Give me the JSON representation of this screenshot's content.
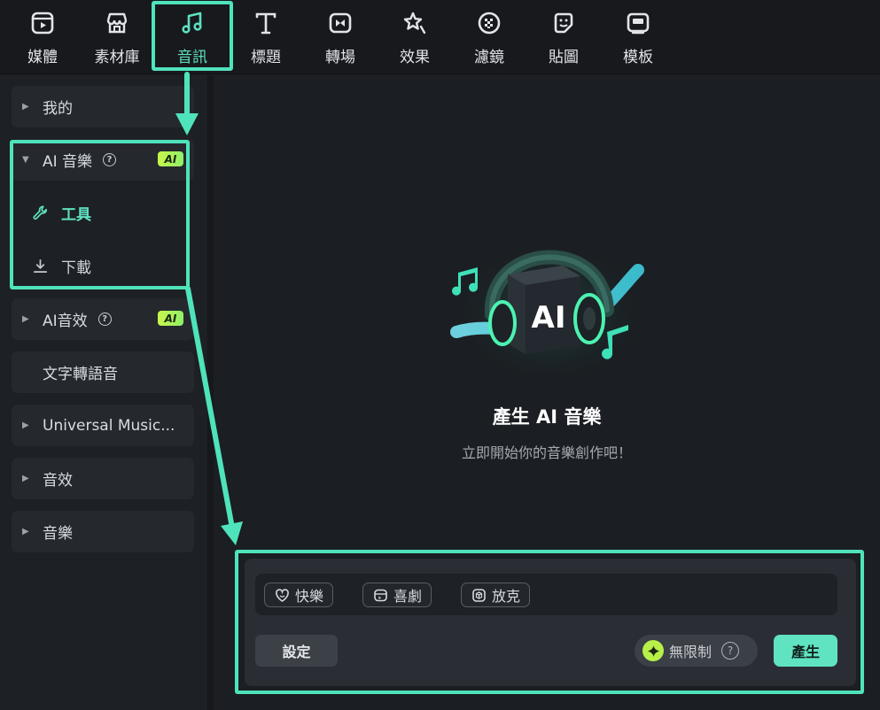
{
  "toolbar": {
    "items": [
      {
        "label": "媒體",
        "icon": "media-icon"
      },
      {
        "label": "素材庫",
        "icon": "store-icon"
      },
      {
        "label": "音訊",
        "icon": "music-note-icon"
      },
      {
        "label": "標題",
        "icon": "title-t-icon"
      },
      {
        "label": "轉場",
        "icon": "transition-icon"
      },
      {
        "label": "效果",
        "icon": "effects-icon"
      },
      {
        "label": "濾鏡",
        "icon": "filter-icon"
      },
      {
        "label": "貼圖",
        "icon": "sticker-icon"
      },
      {
        "label": "模板",
        "icon": "template-icon"
      }
    ],
    "active_item": "音訊"
  },
  "sidebar": {
    "mine": "我的",
    "ai_music": {
      "label": "AI 音樂",
      "badge": "AI",
      "expanded": true
    },
    "tools": "工具",
    "download": "下載",
    "ai_sfx": {
      "label": "AI音效",
      "badge": "AI"
    },
    "tts": "文字轉語音",
    "universal": "Universal Music...",
    "sound_effects": "音效",
    "music": "音樂",
    "help_glyph": "?"
  },
  "main": {
    "hero_badge": "AI",
    "title": "產生 AI 音樂",
    "subtitle": "立即開始你的音樂創作吧！"
  },
  "panel": {
    "chips": [
      "快樂",
      "喜劇",
      "放克"
    ],
    "settings_label": "設定",
    "unlimited_label": "無限制",
    "help_glyph": "?",
    "generate_label": "產生"
  },
  "colors": {
    "accent": "#5fe3c1",
    "highlight": "#4fe3bb",
    "ai_badge": "#b8f04a",
    "background": "#1b1e22"
  }
}
